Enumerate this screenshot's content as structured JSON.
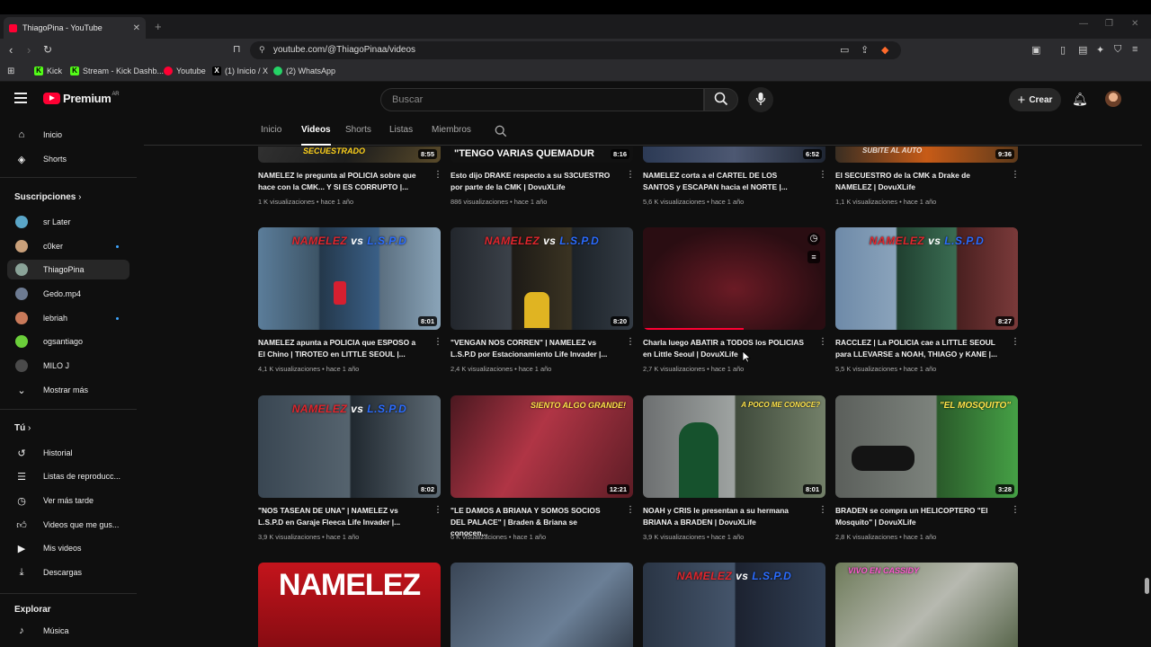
{
  "browser": {
    "tab_title": "ThiagoPina - YouTube",
    "url": "youtube.com/@ThiagoPinaa/videos",
    "bookmarks": [
      "Kick",
      "Stream - Kick Dashb...",
      "Youtube",
      "(1) Inicio / X",
      "(2) WhatsApp"
    ]
  },
  "header": {
    "logo_text": "Premium",
    "logo_sup": "AR",
    "search_placeholder": "Buscar",
    "create_label": "Crear"
  },
  "sidebar": {
    "main": [
      {
        "icon": "home-icon",
        "label": "Inicio"
      },
      {
        "icon": "shorts-icon",
        "label": "Shorts"
      }
    ],
    "subs_title": "Suscripciones",
    "subs": [
      {
        "label": "sr Later",
        "color": "#5aa6c8",
        "dot": false
      },
      {
        "label": "c0ker",
        "color": "#c9a07a",
        "dot": true
      },
      {
        "label": "ThiagoPina",
        "color": "#8aa398",
        "dot": false,
        "active": true
      },
      {
        "label": "Gedo.mp4",
        "color": "#6d7b92",
        "dot": false
      },
      {
        "label": "lebriah",
        "color": "#c97a5a",
        "dot": true
      },
      {
        "label": "ogsantiago",
        "color": "#6bcf3a",
        "dot": false
      },
      {
        "label": "MILO J",
        "color": "#4a4a4a",
        "dot": false
      }
    ],
    "show_more": "Mostrar más",
    "you_title": "Tú",
    "you": [
      {
        "icon": "history-icon",
        "label": "Historial"
      },
      {
        "icon": "playlist-icon",
        "label": "Listas de reproducc..."
      },
      {
        "icon": "watch-later-icon",
        "label": "Ver más tarde"
      },
      {
        "icon": "like-icon",
        "label": "Videos que me gus..."
      },
      {
        "icon": "my-videos-icon",
        "label": "Mis videos"
      },
      {
        "icon": "download-icon",
        "label": "Descargas"
      }
    ],
    "explore_title": "Explorar",
    "explore_first": "Música"
  },
  "channel_tabs": [
    "Inicio",
    "Videos",
    "Shorts",
    "Listas",
    "Miembros"
  ],
  "videos": [
    {
      "title": "NAMELEZ le pregunta al POLICIA sobre que hace con la CMK... Y SI ES CORRUPTO |...",
      "meta": "1 K visualizaciones • hace 1 año",
      "duration": "8:55",
      "caption": "SECUESTRADO"
    },
    {
      "title": "Esto dijo DRAKE respecto a su S3CUESTRO por parte de la CMK | DovuXLife",
      "meta": "886 visualizaciones • hace 1 año",
      "duration": "8:16",
      "caption": "\"TENGO VARIAS QUEMADUR"
    },
    {
      "title": "NAMELEZ corta a el CARTEL DE LOS SANTOS y ESCAPAN hacia el NORTE |...",
      "meta": "5,6 K visualizaciones • hace 1 año",
      "duration": "6:52",
      "caption": ""
    },
    {
      "title": "El SECUESTRO de la CMK a Drake de NAMELEZ | DovuXLife",
      "meta": "1,1 K visualizaciones • hace 1 año",
      "duration": "9:36",
      "caption": "SUBITE AL AUTO"
    },
    {
      "title": "NAMELEZ apunta a POLICIA que ESPOSO a El Chino | TIROTEO en LITTLE SEOUL |...",
      "meta": "4,1 K visualizaciones • hace 1 año",
      "duration": "8:01",
      "overlay": true
    },
    {
      "title": "\"VENGAN NOS CORREN\" | NAMELEZ vs L.S.P.D por Estacionamiento Life Invader |...",
      "meta": "2,4 K visualizaciones • hace 1 año",
      "duration": "8:20",
      "overlay": true
    },
    {
      "title": "Charla luego ABATIR a TODOS los POLICIAS en Little Seoul | DovuXLife",
      "meta": "2,7 K visualizaciones • hace 1 año",
      "duration": "",
      "overlay": false
    },
    {
      "title": "RACCLEZ | La POLICIA cae a LITTLE SEOUL para LLEVARSE a NOAH, THIAGO y KANE |...",
      "meta": "5,5 K visualizaciones • hace 1 año",
      "duration": "8:27",
      "overlay": true
    },
    {
      "title": "\"NOS TASEAN DE UNA\" | NAMELEZ vs L.S.P.D en Garaje Fleeca Life Invader |...",
      "meta": "3,9 K visualizaciones • hace 1 año",
      "duration": "8:02",
      "overlay": true
    },
    {
      "title": "\"LE DAMOS A BRIANA Y SOMOS SOCIOS DEL PALACE\" | Braden & Briana se conocen...",
      "meta": "6 K visualizaciones • hace 1 año",
      "duration": "12:21",
      "caption": "SIENTO ALGO GRANDE!"
    },
    {
      "title": "NOAH y CRIS le presentan a su hermana BRIANA a BRADEN | DovuXLife",
      "meta": "3,9 K visualizaciones • hace 1 año",
      "duration": "8:01",
      "caption": "A POCO ME CONOCE?"
    },
    {
      "title": "BRADEN se compra un HELICOPTERO \"El Mosquito\" | DovuXLife",
      "meta": "2,8 K visualizaciones • hace 1 año",
      "duration": "3:28",
      "caption": "\"EL MOSQUITO\""
    }
  ],
  "overlay_text": {
    "a": "NAMELEZ",
    "b": "vs",
    "c": "L.S.P.D"
  },
  "bottom_row_caption": "NAMELEZ",
  "bottom_row_caption_4": "VIVO EN CASSIDY"
}
